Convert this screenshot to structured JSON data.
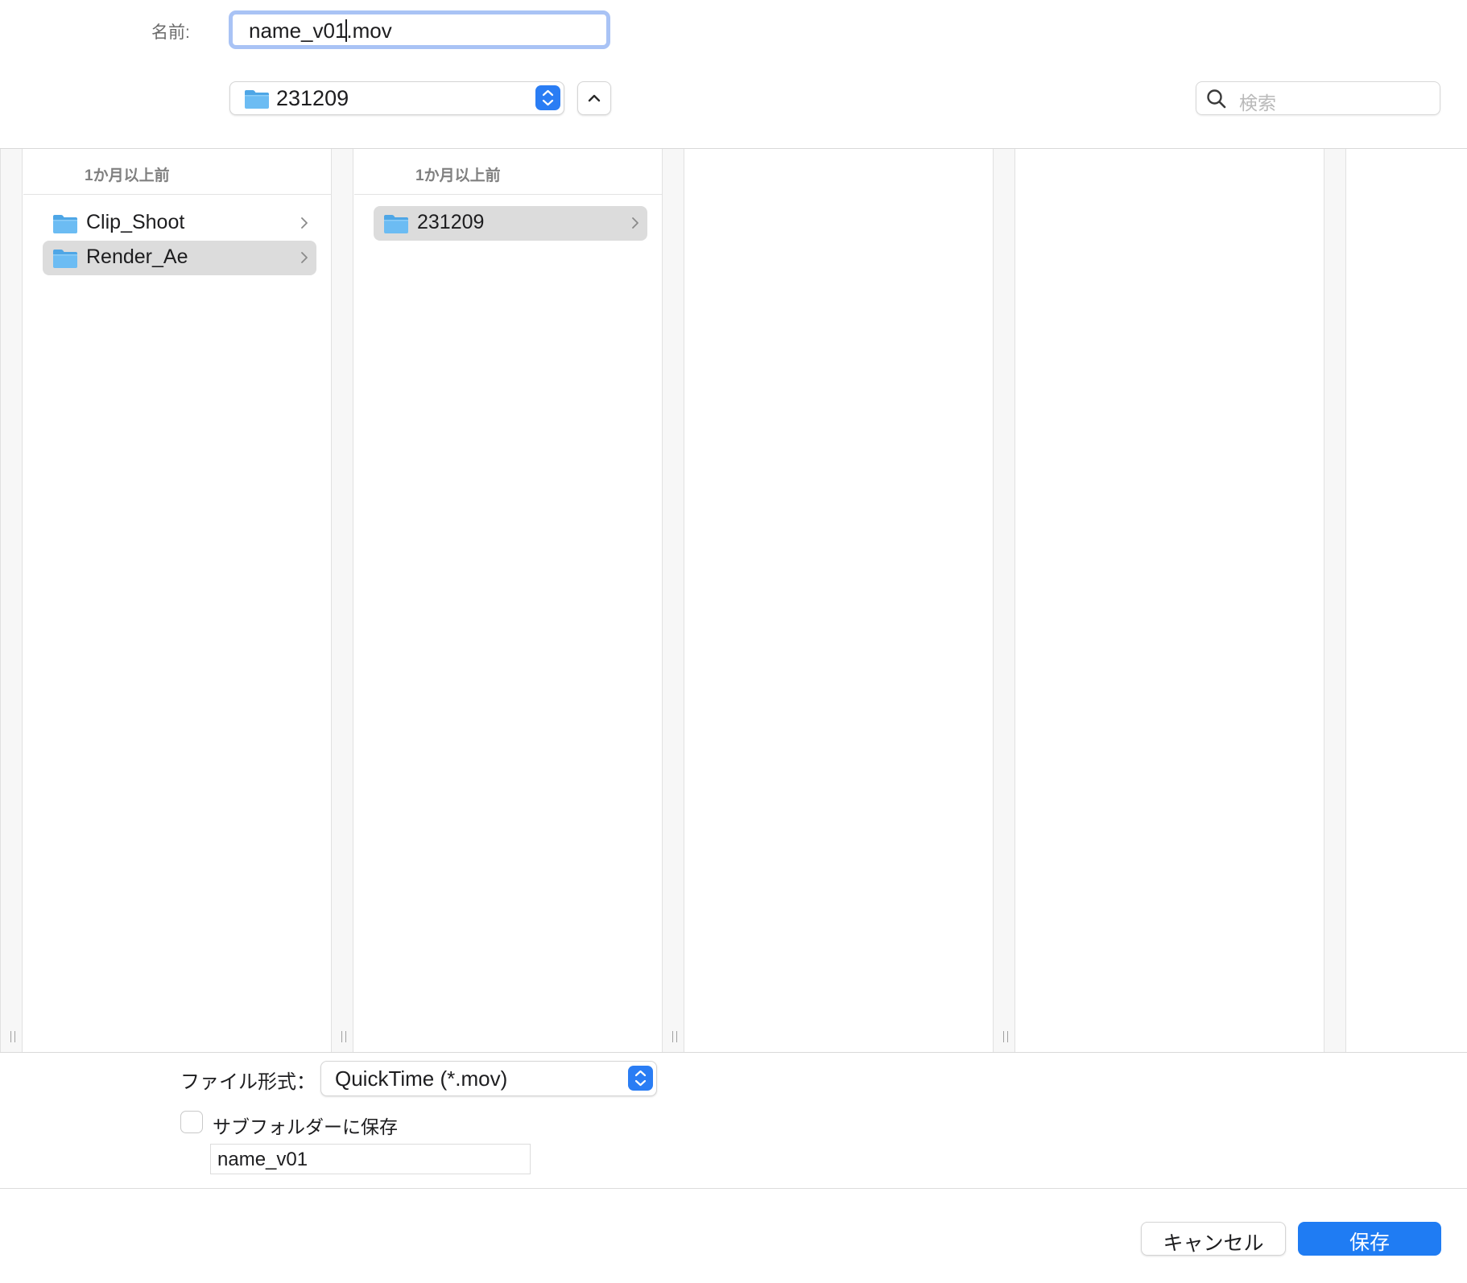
{
  "name_row": {
    "label": "名前:",
    "value_before_caret": "name_v01",
    "value_after_caret": ".mov"
  },
  "location": {
    "folder": "231209",
    "folder_icon": "folder-icon"
  },
  "search": {
    "placeholder": "検索"
  },
  "columns": [
    {
      "header": "1か月以上前",
      "items": [
        {
          "label": "Clip_Shoot",
          "selected": false
        },
        {
          "label": "Render_Ae",
          "selected": true
        }
      ]
    },
    {
      "header": "1か月以上前",
      "items": [
        {
          "label": "231209",
          "selected": true
        }
      ]
    },
    {
      "header": "",
      "items": []
    },
    {
      "header": "",
      "items": []
    }
  ],
  "options": {
    "format_label": "ファイル形式：",
    "format_value": "QuickTime (*.mov)",
    "subfolder_label": "サブフォルダーに保存",
    "subfolder_checked": false,
    "subfolder_name": "name_v01"
  },
  "buttons": {
    "cancel": "キャンセル",
    "save": "保存"
  },
  "colors": {
    "accent": "#1f7cf3",
    "folder": "#5db2ef",
    "selection": "#dcdcdc"
  }
}
